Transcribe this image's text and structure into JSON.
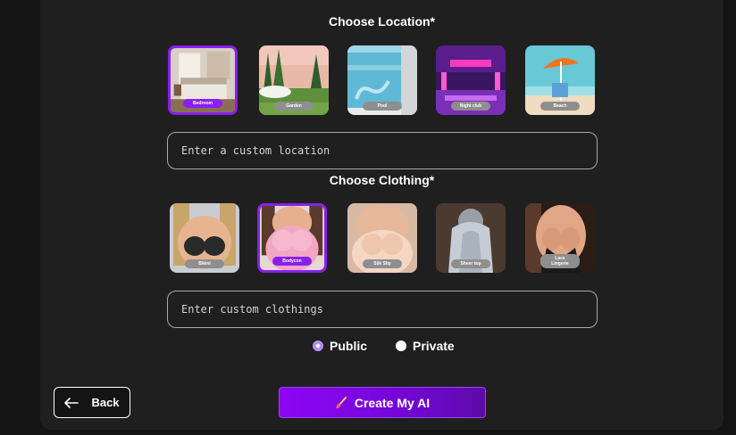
{
  "location": {
    "title": "Choose Location*",
    "tiles": [
      {
        "label": "Bedroom",
        "selected": true
      },
      {
        "label": "Garden",
        "selected": false
      },
      {
        "label": "Pool",
        "selected": false
      },
      {
        "label": "Night club",
        "selected": false
      },
      {
        "label": "Beach",
        "selected": false
      }
    ],
    "custom_placeholder": "Enter a custom location"
  },
  "clothing": {
    "title": "Choose Clothing*",
    "tiles": [
      {
        "label": "Bikini",
        "selected": false
      },
      {
        "label": "Bodycon",
        "selected": true
      },
      {
        "label": "Silk Slip",
        "selected": false
      },
      {
        "label": "Sheer top",
        "selected": false
      },
      {
        "label": "Lace Lingerie",
        "selected": false
      }
    ],
    "custom_placeholder": "Enter custom clothings"
  },
  "visibility": {
    "options": [
      {
        "label": "Public",
        "selected": true
      },
      {
        "label": "Private",
        "selected": false
      }
    ]
  },
  "actions": {
    "back_label": "Back",
    "create_label": "Create My AI",
    "create_icon": "brush-icon",
    "back_icon": "arrow-left-icon"
  },
  "colors": {
    "accent": "#8a1ef0",
    "background": "#1f1f1f"
  }
}
